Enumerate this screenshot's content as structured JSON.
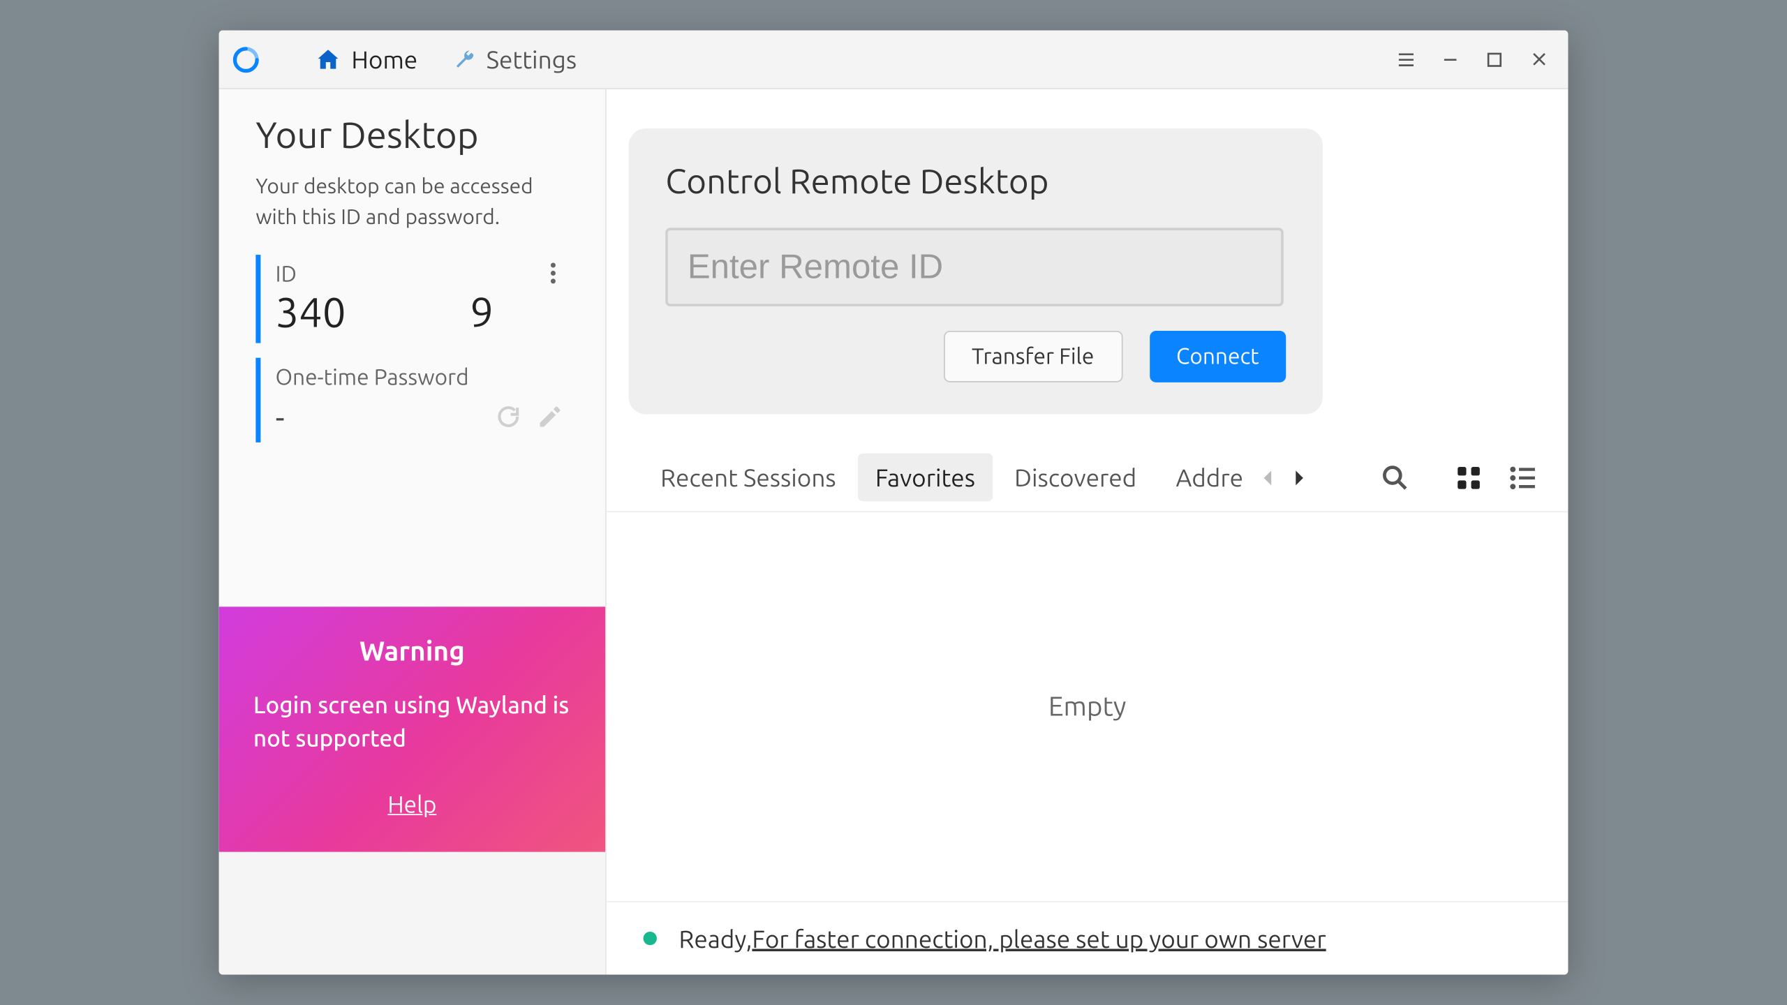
{
  "titlebar": {
    "tabs": {
      "home": "Home",
      "settings": "Settings"
    }
  },
  "sidebar": {
    "title": "Your Desktop",
    "subtitle": "Your desktop can be accessed with this ID and password.",
    "id_label": "ID",
    "id_value": "340             9",
    "pw_label": "One-time Password",
    "pw_value": "-",
    "warning": {
      "title": "Warning",
      "message": "Login screen using Wayland is not supported",
      "help": "Help"
    }
  },
  "main": {
    "card_title": "Control Remote Desktop",
    "remote_placeholder": "Enter Remote ID",
    "transfer_label": "Transfer File",
    "connect_label": "Connect",
    "tabs": {
      "recent": "Recent Sessions",
      "favorites": "Favorites",
      "discovered": "Discovered",
      "address": "Addre"
    },
    "empty": "Empty"
  },
  "status": {
    "ready": "Ready, ",
    "link": "For faster connection, please set up your own server"
  }
}
